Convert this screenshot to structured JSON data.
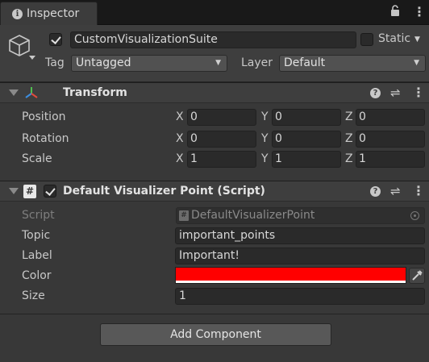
{
  "tab": {
    "title": "Inspector",
    "info_icon": "i"
  },
  "tabbar_icons": {
    "lock": "lock-icon",
    "menu": "kebab-menu-icon"
  },
  "gameobject": {
    "active": true,
    "name": "CustomVisualizationSuite",
    "static_label": "Static",
    "static_checked": false,
    "tag_label": "Tag",
    "tag_value": "Untagged",
    "layer_label": "Layer",
    "layer_value": "Default"
  },
  "transform": {
    "title": "Transform",
    "rows": [
      {
        "label": "Position",
        "x": "0",
        "y": "0",
        "z": "0"
      },
      {
        "label": "Rotation",
        "x": "0",
        "y": "0",
        "z": "0"
      },
      {
        "label": "Scale",
        "x": "1",
        "y": "1",
        "z": "1"
      }
    ],
    "axis": {
      "x": "X",
      "y": "Y",
      "z": "Z"
    }
  },
  "script_component": {
    "title": "Default Visualizer Point (Script)",
    "enabled": true,
    "script_label": "Script",
    "script_value": "DefaultVisualizerPoint",
    "topic_label": "Topic",
    "topic_value": "important_points",
    "label_label": "Label",
    "label_value": "Important!",
    "color_label": "Color",
    "color_value": "#ff0000",
    "size_label": "Size",
    "size_value": "1"
  },
  "add_component_label": "Add Component",
  "colors": {
    "background": "#383838",
    "field": "#2a2a2a",
    "color_swatch": "#ff0000"
  }
}
